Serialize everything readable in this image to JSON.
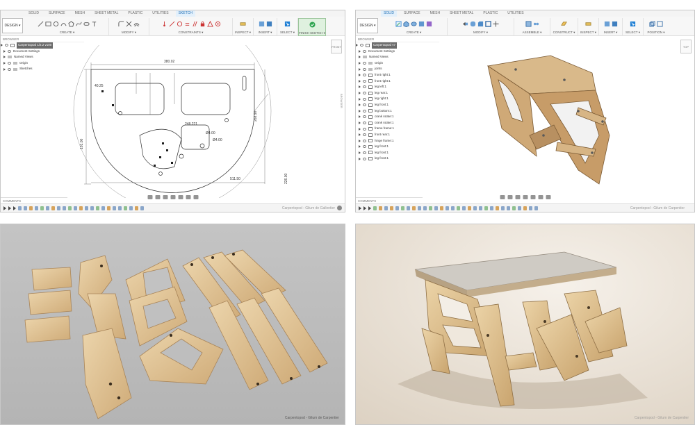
{
  "sketch_panel": {
    "tabs": [
      "SOLID",
      "SURFACE",
      "MESH",
      "SHEET METAL",
      "PLASTIC",
      "UTILITIES",
      "SKETCH"
    ],
    "active_tab": "SKETCH",
    "design_button": "DESIGN ▾",
    "groups": [
      "CREATE ▾",
      "MODIFY ▾",
      "CONSTRAINTS ▾",
      "INSPECT ▾",
      "INSERT ▾",
      "SELECT ▾",
      "FINISH SKETCH ▾"
    ],
    "browser_header": "BROWSER",
    "browser_items": [
      "Carpentopod 1/2.2 v100",
      "Document Settings",
      "Named Views",
      "Origin",
      "Sketches"
    ],
    "comments_label": "COMMENTS",
    "sidebar_label": "BROWSER",
    "dimensions": {
      "top": "380.02",
      "d1": "40.25",
      "d2": "248.221",
      "d3": "268.90",
      "d4": "Ø4.00",
      "d5": "Ø4.00",
      "right": "226.00",
      "bottom": "511.50",
      "left": "101.00"
    },
    "watermark": "Carpentopod - Gilum de Gallentier"
  },
  "model_panel": {
    "tabs": [
      "SOLID",
      "SURFACE",
      "MESH",
      "SHEET METAL",
      "PLASTIC",
      "UTILITIES"
    ],
    "active_tab": "SOLID",
    "design_button": "DESIGN ▾",
    "groups": [
      "CREATE ▾",
      "MODIFY ▾",
      "ASSEMBLE ▾",
      "CONSTRUCT ▾",
      "INSPECT ▾",
      "INSERT ▾",
      "SELECT ▾",
      "POSITION ▾"
    ],
    "browser_header": "BROWSER",
    "browser_items": [
      "Carpentopod v7",
      "Document Settings",
      "Named Views",
      "Origin",
      "joints",
      "front right:1",
      "front right:1",
      "leg left:1",
      "leg rear:1",
      "leg right:1",
      "leg front:1",
      "leg bottom:1",
      "crank rotate:1",
      "crank rotate:1",
      "frame frame:1",
      "front rear:1",
      "hinge frame:1",
      "leg front:1",
      "leg front:1",
      "leg front:1"
    ],
    "comments_label": "COMMENTS",
    "watermark": "Carpentopod - Gilum de Carpentier"
  },
  "parts_photo": {
    "caption": "Carpentopod - Gilum de Carpentier"
  },
  "assembled_photo": {
    "caption": "Carpentopod - Gilum de Carpentier"
  },
  "colors": {
    "accent": "#1f7fd4",
    "wood_light": "#e8cfa3",
    "wood_mid": "#d7b585",
    "wood_dark": "#b78f5e",
    "floor_grey": "#bfbfbf",
    "sand": "#ebe3d8"
  }
}
